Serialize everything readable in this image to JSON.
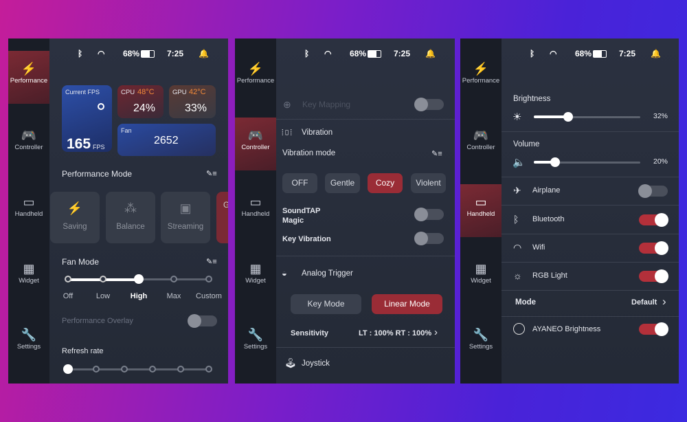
{
  "status": {
    "battery": "68%",
    "time": "7:25"
  },
  "sidebar": [
    {
      "label": "Performance",
      "icon": "lightning-icon",
      "glyph": "⚡"
    },
    {
      "label": "Controller",
      "icon": "gamepad-icon",
      "glyph": "🎮"
    },
    {
      "label": "Handheld",
      "icon": "handheld-icon",
      "glyph": "▭"
    },
    {
      "label": "Widget",
      "icon": "widget-icon",
      "glyph": "▦"
    },
    {
      "label": "Settings",
      "icon": "wrench-icon",
      "glyph": "🔧"
    }
  ],
  "performance": {
    "fps_label": "Current FPS",
    "fps": "165",
    "fps_unit": "FPS",
    "cpu_label": "CPU",
    "cpu_temp": "48°C",
    "cpu_usage": "24%",
    "gpu_label": "GPU",
    "gpu_temp": "42°C",
    "gpu_usage": "33%",
    "fan_label": "Fan",
    "fan_rpm": "2652",
    "mode_title": "Performance Mode",
    "modes": [
      "Saving",
      "Balance",
      "Streaming",
      "G"
    ],
    "fan_title": "Fan Mode",
    "fan_modes": [
      "Off",
      "Low",
      "High",
      "Max",
      "Custom"
    ],
    "fan_selected": "High",
    "overlay_label": "Performance Overlay",
    "overlay_on": false,
    "refresh_title": "Refresh rate"
  },
  "controller": {
    "key_mapping": "Key Mapping",
    "key_mapping_on": false,
    "vibration": "Vibration",
    "vibration_mode": "Vibration mode",
    "vib_options": [
      "OFF",
      "Gentle",
      "Cozy",
      "Violent"
    ],
    "vib_selected": "Cozy",
    "soundtap": "SoundTAP Magic",
    "soundtap_on": false,
    "key_vibration": "Key Vibration",
    "key_vibration_on": false,
    "analog_trigger": "Analog Trigger",
    "trigger_modes": [
      "Key Mode",
      "Linear Mode"
    ],
    "trigger_selected": "Linear Mode",
    "sensitivity": "Sensitivity",
    "sensitivity_value": "LT : 100% RT : 100%",
    "joystick": "Joystick"
  },
  "handheld": {
    "brightness": "Brightness",
    "brightness_value": "32%",
    "brightness_level": 32,
    "volume": "Volume",
    "volume_value": "20%",
    "volume_level": 20,
    "toggles": [
      {
        "label": "Airplane",
        "on": false,
        "glyph": "✈",
        "icon": "airplane-icon"
      },
      {
        "label": "Bluetooth",
        "on": true,
        "glyph": "ᛒ",
        "icon": "bluetooth-icon"
      },
      {
        "label": "Wifi",
        "on": true,
        "glyph": "◠",
        "icon": "wifi-icon"
      },
      {
        "label": "RGB Light",
        "on": true,
        "glyph": "☼",
        "icon": "rgb-light-icon"
      }
    ],
    "mode_label": "Mode",
    "mode_value": "Default",
    "ayaneo": "AYANEO Brightness",
    "ayaneo_on": true
  },
  "colors": {
    "accent": "#9a2c36",
    "temp": "#f08a3a",
    "panel": "#262c38"
  }
}
